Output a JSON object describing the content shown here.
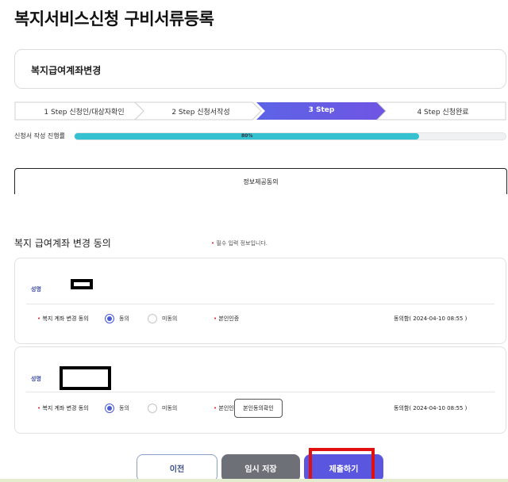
{
  "page": {
    "title": "복지서비스신청 구비서류등록"
  },
  "section": {
    "label": "복지급여계좌변경"
  },
  "steps": [
    {
      "label": "1 Step 신청인/대상자확인",
      "active": false
    },
    {
      "label": "2 Step 신청서작성",
      "active": false
    },
    {
      "label": "3 Step",
      "active": true
    },
    {
      "label": "4 Step 신청완료",
      "active": false
    }
  ],
  "progress": {
    "label": "신청서 작성 진행률",
    "value_text": "80%",
    "value": 0.8,
    "color": "#35c1cf"
  },
  "tab": {
    "label": "정보제공동의"
  },
  "form": {
    "heading": "복지 급여계좌 변경 동의",
    "required_note": "필수 입력 정보입니다.",
    "required_mark": "•"
  },
  "cards": [
    {
      "name_label": "성명",
      "consent_label": "복지 계좌 변경 동의",
      "agree_label": "동의",
      "disagree_label": "미동의",
      "selected": "agree",
      "verify_label": "본인인증",
      "verify_button": "",
      "agree_date": "동의함( 2024-04-10 08:55 )"
    },
    {
      "name_label": "성명",
      "consent_label": "복지 계좌 변경 동의",
      "agree_label": "동의",
      "disagree_label": "미동의",
      "selected": "agree",
      "verify_label": "본인인증",
      "verify_button": "본인동의확인",
      "agree_date": "동의함( 2024-04-10 08:55 )"
    }
  ],
  "buttons": {
    "prev": "이전",
    "save": "임시 저장",
    "submit": "제출하기"
  },
  "colors": {
    "accent": "#5a56e0",
    "progress": "#35c1cf",
    "required": "#dd2233",
    "highlight": "#e01010"
  }
}
